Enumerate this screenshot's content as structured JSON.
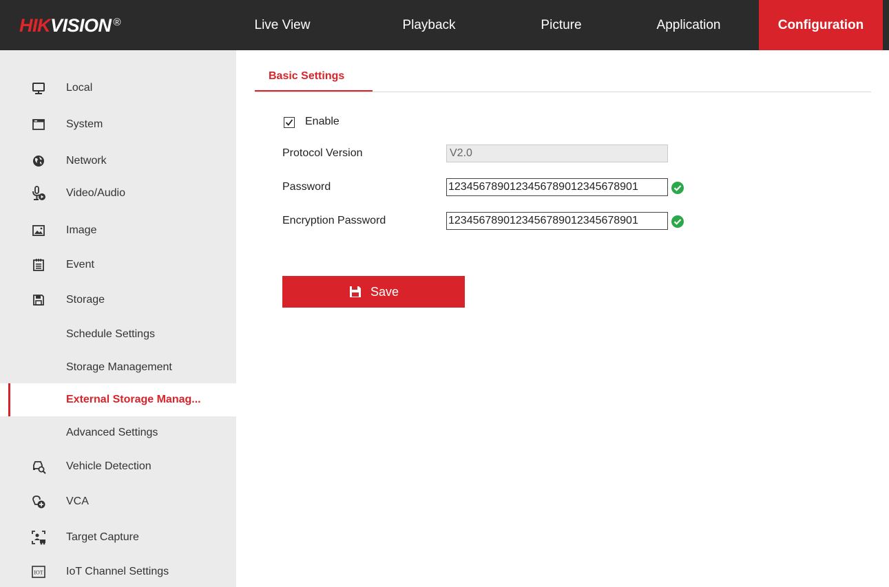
{
  "header": {
    "logo": {
      "part1": "HIK",
      "part2": "VISION",
      "reg": "®"
    },
    "nav": [
      {
        "label": "Live View",
        "active": false
      },
      {
        "label": "Playback",
        "active": false
      },
      {
        "label": "Picture",
        "active": false
      },
      {
        "label": "Application",
        "active": false
      },
      {
        "label": "Configuration",
        "active": true
      }
    ]
  },
  "sidebar": {
    "items": [
      {
        "label": "Local",
        "icon": "monitor-icon"
      },
      {
        "label": "System",
        "icon": "window-icon"
      },
      {
        "label": "Network",
        "icon": "globe-icon"
      },
      {
        "label": "Video/Audio",
        "icon": "microphone-icon"
      },
      {
        "label": "Image",
        "icon": "image-icon"
      },
      {
        "label": "Event",
        "icon": "calendar-icon"
      },
      {
        "label": "Storage",
        "icon": "floppy-icon"
      },
      {
        "label": "Schedule Settings"
      },
      {
        "label": "Storage Management"
      },
      {
        "label": "External Storage Manag...",
        "active": true
      },
      {
        "label": "Advanced Settings"
      },
      {
        "label": "Vehicle Detection",
        "icon": "vehicle-search-icon"
      },
      {
        "label": "VCA",
        "icon": "vca-icon"
      },
      {
        "label": "Target Capture",
        "icon": "target-capture-icon"
      },
      {
        "label": "IoT Channel Settings",
        "icon": "iot-icon"
      }
    ]
  },
  "main": {
    "tab": "Basic Settings",
    "enable": {
      "label": "Enable",
      "checked": true
    },
    "fields": {
      "protocol_version": {
        "label": "Protocol Version",
        "value": "V2.0"
      },
      "password": {
        "label": "Password",
        "value": "1234567890123456789012345678901"
      },
      "encryption_password": {
        "label": "Encryption Password",
        "value": "1234567890123456789012345678901"
      }
    },
    "save_label": "Save"
  },
  "colors": {
    "accent": "#d8232a",
    "header_bg": "#2b2b2b",
    "sidebar_bg": "#ebebeb",
    "ok_green": "#2aa84a"
  }
}
